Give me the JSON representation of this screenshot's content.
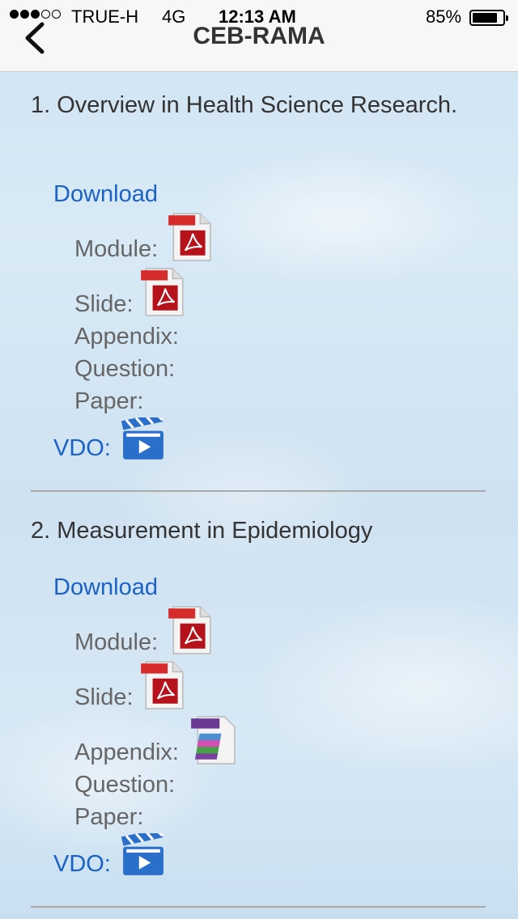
{
  "status": {
    "carrier": "TRUE-H",
    "network": "4G",
    "time": "12:13 AM",
    "battery": "85%",
    "battery_level": 0.85
  },
  "nav": {
    "title": "CEB-RAMA",
    "back_icon": "chevron-left-icon"
  },
  "sections": [
    {
      "title": "1. Overview in Health Science Research.",
      "download": "Download",
      "module": "Module:",
      "slide": "Slide:",
      "appendix": "Appendix:",
      "question": "Question:",
      "paper": "Paper:",
      "vdo": "VDO:"
    },
    {
      "title": "2. Measurement in Epidemiology",
      "download": "Download",
      "module": "Module:",
      "slide": "Slide:",
      "appendix": "Appendix:",
      "question": "Question:",
      "paper": "Paper:",
      "vdo": "VDO:"
    }
  ],
  "icon_labels": {
    "pdf": "PDF",
    "rar": "RAR"
  },
  "colors": {
    "link": "#1a62c8",
    "pdf": "#c0141b",
    "video": "#2a6fc9",
    "rar": "#7b3fa0"
  }
}
